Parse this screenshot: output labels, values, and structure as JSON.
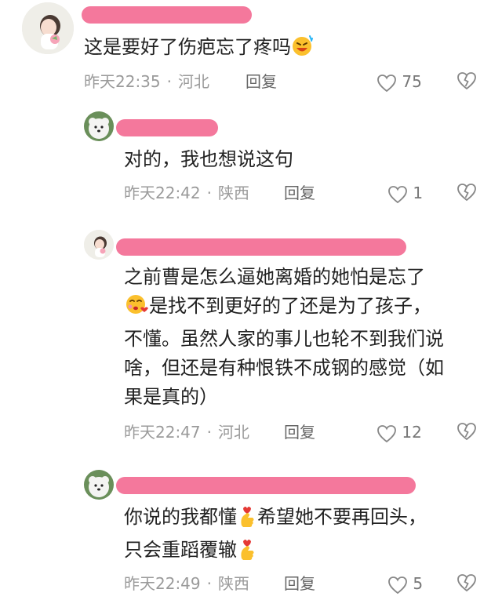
{
  "comments": [
    {
      "text_lines": [
        "这是要好了伤疤忘了疼吗"
      ],
      "time": "昨天22:35",
      "location": "河北",
      "reply_label": "回复",
      "likes": "75"
    },
    {
      "text_lines": [
        "对的，我也想说这句"
      ],
      "time": "昨天22:42",
      "location": "陕西",
      "reply_label": "回复",
      "likes": "1"
    },
    {
      "text_lines": [
        "之前曹是怎么逼她离婚的她怕是忘了",
        "是找不到更好的了还是为了孩子，",
        "不懂。虽然人家的事儿也轮不到我们说",
        "啥，但还是有种恨铁不成钢的感觉（如",
        "果是真的）"
      ],
      "time": "昨天22:47",
      "location": "河北",
      "reply_label": "回复",
      "likes": "12"
    },
    {
      "text_lines": [
        "你说的我都懂",
        "希望她不要再回头，",
        "只会重蹈覆辙"
      ],
      "time": "昨天22:49",
      "location": "陕西",
      "reply_label": "回复",
      "likes": "5"
    }
  ],
  "colors": {
    "name_redaction": "#f4789c",
    "meta_text": "#9a9a9a",
    "body_text": "#222222"
  },
  "icons": {
    "like": "heart-outline-icon",
    "dislike": "broken-heart-icon",
    "emoji_1": "laughing-sweat-emoji-icon",
    "emoji_2": "kissing-face-emoji-icon",
    "emoji_3": "finger-heart-emoji-icon"
  }
}
